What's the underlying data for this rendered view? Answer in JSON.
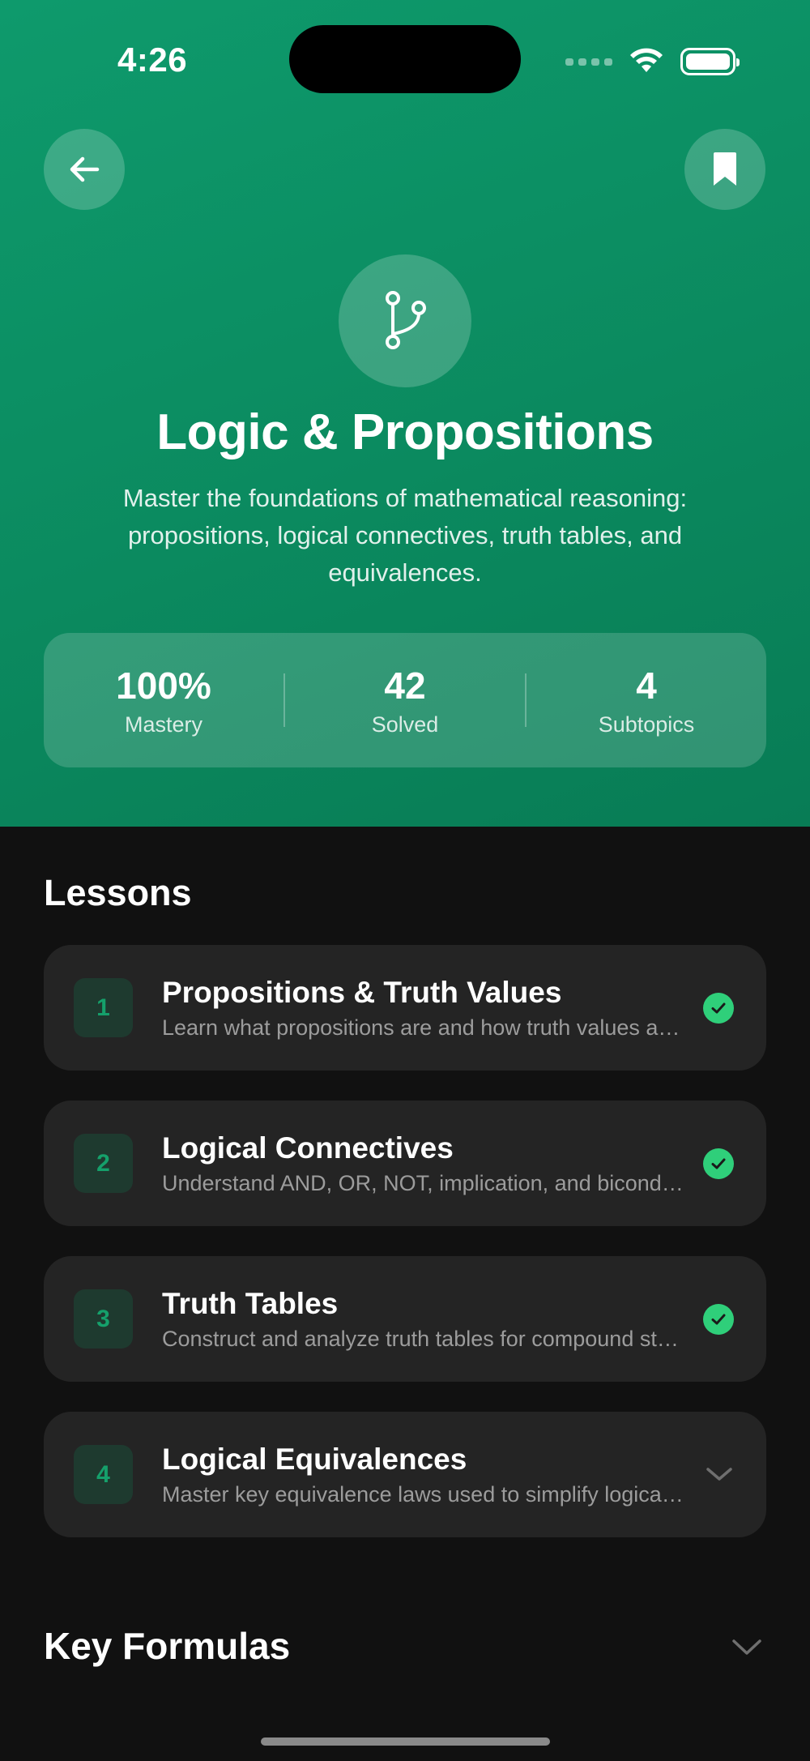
{
  "status_bar": {
    "time": "4:26"
  },
  "header": {
    "back_icon": "arrow-left-icon",
    "bookmark_icon": "bookmark-icon",
    "topic_icon": "git-branch-icon",
    "title": "Logic & Propositions",
    "description": "Master the foundations of mathematical reasoning: propositions, logical connectives, truth tables, and equivalences."
  },
  "stats": [
    {
      "value": "100%",
      "label": "Mastery"
    },
    {
      "value": "42",
      "label": "Solved"
    },
    {
      "value": "4",
      "label": "Subtopics"
    }
  ],
  "lessons_section": {
    "title": "Lessons",
    "items": [
      {
        "number": "1",
        "title": "Propositions & Truth Values",
        "subtitle": "Learn what propositions are and how truth values are assigned",
        "status": "completed"
      },
      {
        "number": "2",
        "title": "Logical Connectives",
        "subtitle": "Understand AND, OR, NOT, implication, and biconditional",
        "status": "completed"
      },
      {
        "number": "3",
        "title": "Truth Tables",
        "subtitle": "Construct and analyze truth tables for compound statements",
        "status": "completed"
      },
      {
        "number": "4",
        "title": "Logical Equivalences",
        "subtitle": "Master key equivalence laws used to simplify logical expressions",
        "status": "collapsed"
      }
    ]
  },
  "key_formulas": {
    "title": "Key Formulas"
  },
  "colors": {
    "hero_green": "#0b8a5f",
    "accent_green": "#2fcf7a",
    "background": "#111111",
    "card": "#242424"
  }
}
